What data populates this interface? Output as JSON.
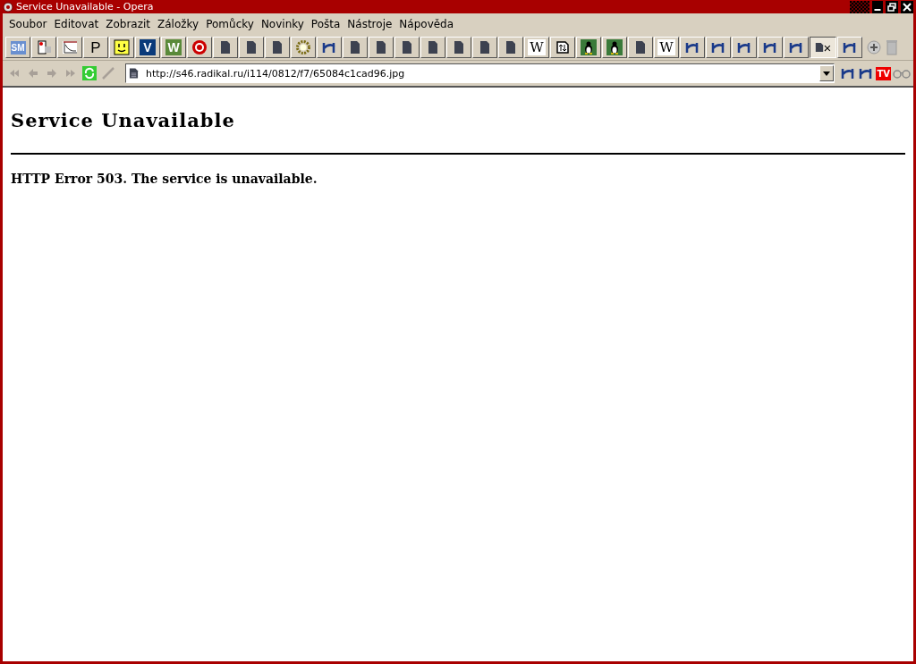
{
  "window": {
    "title": "Service Unavailable - Opera"
  },
  "menu": [
    {
      "label": "Soubor"
    },
    {
      "label": "Editovat"
    },
    {
      "label": "Zobrazit"
    },
    {
      "label": "Záložky"
    },
    {
      "label": "Pomůcky"
    },
    {
      "label": "Novinky"
    },
    {
      "label": "Pošta"
    },
    {
      "label": "Nástroje"
    },
    {
      "label": "Nápověda"
    }
  ],
  "bookmarks": [
    {
      "kind": "sm",
      "glyph": "SM",
      "pressed": false
    },
    {
      "kind": "device",
      "pressed": false
    },
    {
      "kind": "chart",
      "pressed": false
    },
    {
      "kind": "letter",
      "glyph": "P",
      "pressed": false
    },
    {
      "kind": "smiley",
      "pressed": false
    },
    {
      "kind": "tile",
      "glyph": "V",
      "color": "#0a3a7a",
      "pressed": false
    },
    {
      "kind": "tile",
      "glyph": "W",
      "color": "#5a8a3a",
      "pressed": false
    },
    {
      "kind": "wheel",
      "pressed": false
    },
    {
      "kind": "page",
      "pressed": false
    },
    {
      "kind": "page",
      "pressed": false
    },
    {
      "kind": "page",
      "pressed": false
    },
    {
      "kind": "gear",
      "pressed": false
    },
    {
      "kind": "xwing",
      "pressed": false
    },
    {
      "kind": "page",
      "pressed": false
    },
    {
      "kind": "page",
      "pressed": false
    },
    {
      "kind": "page",
      "pressed": false
    },
    {
      "kind": "page",
      "pressed": false
    },
    {
      "kind": "page",
      "pressed": false
    },
    {
      "kind": "page",
      "pressed": false
    },
    {
      "kind": "page",
      "pressed": false
    },
    {
      "kind": "wiki",
      "glyph": "W",
      "pressed": false
    },
    {
      "kind": "updown",
      "pressed": false
    },
    {
      "kind": "penguin",
      "pressed": false
    },
    {
      "kind": "penguin",
      "pressed": false
    },
    {
      "kind": "page",
      "pressed": false
    },
    {
      "kind": "wiki",
      "glyph": "W",
      "pressed": false
    },
    {
      "kind": "xwing",
      "pressed": false
    },
    {
      "kind": "xwing",
      "pressed": false
    },
    {
      "kind": "xwing",
      "pressed": false
    },
    {
      "kind": "xwing",
      "pressed": false
    },
    {
      "kind": "xwing",
      "pressed": false
    },
    {
      "kind": "tab",
      "glyph": "×",
      "pressed": true
    },
    {
      "kind": "xwing",
      "pressed": false
    }
  ],
  "nav": [
    {
      "kind": "rewind",
      "disabled": true
    },
    {
      "kind": "back",
      "disabled": true
    },
    {
      "kind": "forward",
      "disabled": true
    },
    {
      "kind": "fastforward",
      "disabled": true
    },
    {
      "kind": "reload",
      "disabled": false
    },
    {
      "kind": "wand",
      "disabled": true
    }
  ],
  "address": {
    "value": "http://s46.radikal.ru/i114/0812/f7/65084c1cad96.jpg"
  },
  "address_tools": [
    {
      "kind": "xwing"
    },
    {
      "kind": "xwing"
    },
    {
      "kind": "tv",
      "glyph": "TV"
    },
    {
      "kind": "glasses"
    }
  ],
  "page": {
    "heading": "Service Unavailable",
    "message": "HTTP Error 503. The service is unavailable."
  }
}
